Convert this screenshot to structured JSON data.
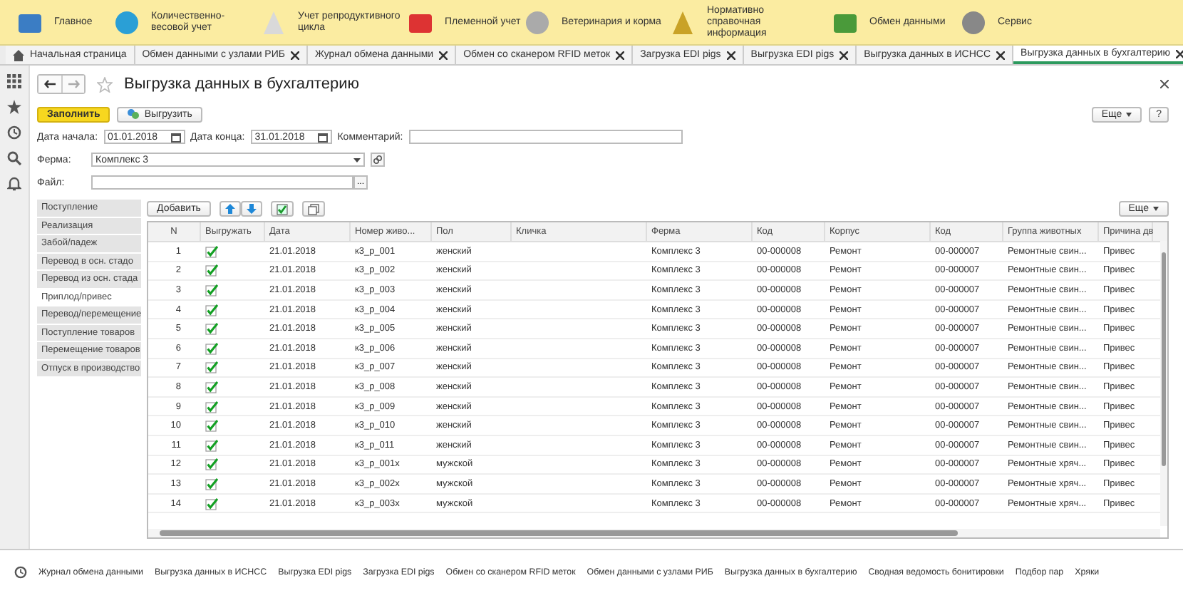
{
  "sections": [
    {
      "label": "Главное"
    },
    {
      "label": "Количественно-весовой учет"
    },
    {
      "label": "Учет репродуктивного цикла"
    },
    {
      "label": "Племенной учет"
    },
    {
      "label": "Ветеринария и корма"
    },
    {
      "label": "Нормативно справочная информация"
    },
    {
      "label": "Обмен данными"
    },
    {
      "label": "Сервис"
    }
  ],
  "tabs": [
    {
      "label": "Начальная страница",
      "selected": false,
      "closable": false
    },
    {
      "label": "Обмен данными с узлами РИБ",
      "selected": false,
      "closable": true
    },
    {
      "label": "Журнал обмена данными",
      "selected": false,
      "closable": true
    },
    {
      "label": "Обмен со сканером RFID меток",
      "selected": false,
      "closable": true
    },
    {
      "label": "Загрузка EDI pigs",
      "selected": false,
      "closable": true
    },
    {
      "label": "Выгрузка EDI pigs",
      "selected": false,
      "closable": true
    },
    {
      "label": "Выгрузка данных в ИСНСС",
      "selected": false,
      "closable": true
    },
    {
      "label": "Выгрузка данных в бухгалтерию",
      "selected": true,
      "closable": true
    }
  ],
  "form": {
    "title": "Выгрузка данных в бухгалтерию",
    "fill_button": "Заполнить",
    "export_button": "Выгрузить",
    "more_button": "Еще",
    "help_button": "?",
    "start_label": "Дата начала:",
    "start_value": "01.01.2018",
    "end_label": "Дата конца:",
    "end_value": "31.01.2018",
    "comment_label": "Комментарий:",
    "farm_label": "Ферма:",
    "farm_value": "Комплекс 3",
    "file_label": "Файл:",
    "file_button": "..."
  },
  "doc_types": [
    {
      "label": "Поступление",
      "selected": false
    },
    {
      "label": "Реализация",
      "selected": false
    },
    {
      "label": "Забой/падеж",
      "selected": false
    },
    {
      "label": "Перевод в осн. стадо",
      "selected": false
    },
    {
      "label": "Перевод из осн. стада",
      "selected": false
    },
    {
      "label": "Приплод/привес",
      "selected": true
    },
    {
      "label": "Перевод/перемещение",
      "selected": false
    },
    {
      "label": "Поступление товаров",
      "selected": false
    },
    {
      "label": "Перемещение товаров",
      "selected": false
    },
    {
      "label": "Отпуск в производство",
      "selected": false
    }
  ],
  "table": {
    "add_button": "Добавить",
    "more_button": "Еще",
    "columns": [
      "N",
      "Выгружать",
      "Дата",
      "Номер живо...",
      "Пол",
      "Кличка",
      "Ферма",
      "Код",
      "Корпус",
      "Код",
      "Группа животных",
      "Причина дв"
    ],
    "rows": [
      {
        "n": "1",
        "export": true,
        "date": "21.01.2018",
        "number": "к3_р_001",
        "sex": "женский",
        "farm": "Комплекс 3",
        "code": "00-000008",
        "building": "Ремонт",
        "code_2": "00-000007",
        "group": "Ремонтные свин...",
        "reason": "Привес"
      },
      {
        "n": "2",
        "export": true,
        "date": "21.01.2018",
        "number": "к3_р_002",
        "sex": "женский",
        "farm": "Комплекс 3",
        "code": "00-000008",
        "building": "Ремонт",
        "code_2": "00-000007",
        "group": "Ремонтные свин...",
        "reason": "Привес"
      },
      {
        "n": "3",
        "export": true,
        "date": "21.01.2018",
        "number": "к3_р_003",
        "sex": "женский",
        "farm": "Комплекс 3",
        "code": "00-000008",
        "building": "Ремонт",
        "code_2": "00-000007",
        "group": "Ремонтные свин...",
        "reason": "Привес"
      },
      {
        "n": "4",
        "export": true,
        "date": "21.01.2018",
        "number": "к3_р_004",
        "sex": "женский",
        "farm": "Комплекс 3",
        "code": "00-000008",
        "building": "Ремонт",
        "code_2": "00-000007",
        "group": "Ремонтные свин...",
        "reason": "Привес"
      },
      {
        "n": "5",
        "export": true,
        "date": "21.01.2018",
        "number": "к3_р_005",
        "sex": "женский",
        "farm": "Комплекс 3",
        "code": "00-000008",
        "building": "Ремонт",
        "code_2": "00-000007",
        "group": "Ремонтные свин...",
        "reason": "Привес"
      },
      {
        "n": "6",
        "export": true,
        "date": "21.01.2018",
        "number": "к3_р_006",
        "sex": "женский",
        "farm": "Комплекс 3",
        "code": "00-000008",
        "building": "Ремонт",
        "code_2": "00-000007",
        "group": "Ремонтные свин...",
        "reason": "Привес"
      },
      {
        "n": "7",
        "export": true,
        "date": "21.01.2018",
        "number": "к3_р_007",
        "sex": "женский",
        "farm": "Комплекс 3",
        "code": "00-000008",
        "building": "Ремонт",
        "code_2": "00-000007",
        "group": "Ремонтные свин...",
        "reason": "Привес"
      },
      {
        "n": "8",
        "export": true,
        "date": "21.01.2018",
        "number": "к3_р_008",
        "sex": "женский",
        "farm": "Комплекс 3",
        "code": "00-000008",
        "building": "Ремонт",
        "code_2": "00-000007",
        "group": "Ремонтные свин...",
        "reason": "Привес"
      },
      {
        "n": "9",
        "export": true,
        "date": "21.01.2018",
        "number": "к3_р_009",
        "sex": "женский",
        "farm": "Комплекс 3",
        "code": "00-000008",
        "building": "Ремонт",
        "code_2": "00-000007",
        "group": "Ремонтные свин...",
        "reason": "Привес"
      },
      {
        "n": "10",
        "export": true,
        "date": "21.01.2018",
        "number": "к3_р_010",
        "sex": "женский",
        "farm": "Комплекс 3",
        "code": "00-000008",
        "building": "Ремонт",
        "code_2": "00-000007",
        "group": "Ремонтные свин...",
        "reason": "Привес"
      },
      {
        "n": "11",
        "export": true,
        "date": "21.01.2018",
        "number": "к3_р_011",
        "sex": "женский",
        "farm": "Комплекс 3",
        "code": "00-000008",
        "building": "Ремонт",
        "code_2": "00-000007",
        "group": "Ремонтные свин...",
        "reason": "Привес"
      },
      {
        "n": "12",
        "export": true,
        "date": "21.01.2018",
        "number": "к3_р_001х",
        "sex": "мужской",
        "farm": "Комплекс 3",
        "code": "00-000008",
        "building": "Ремонт",
        "code_2": "00-000007",
        "group": "Ремонтные хряч...",
        "reason": "Привес"
      },
      {
        "n": "13",
        "export": true,
        "date": "21.01.2018",
        "number": "к3_р_002х",
        "sex": "мужской",
        "farm": "Комплекс 3",
        "code": "00-000008",
        "building": "Ремонт",
        "code_2": "00-000007",
        "group": "Ремонтные хряч...",
        "reason": "Привес"
      },
      {
        "n": "14",
        "export": true,
        "date": "21.01.2018",
        "number": "к3_р_003х",
        "sex": "мужской",
        "farm": "Комплекс 3",
        "code": "00-000008",
        "building": "Ремонт",
        "code_2": "00-000007",
        "group": "Ремонтные хряч...",
        "reason": "Привес"
      }
    ]
  },
  "history": [
    "Журнал обмена данными",
    "Выгрузка данных в ИСНСС",
    "Выгрузка EDI pigs",
    "Загрузка EDI pigs",
    "Обмен со сканером RFID меток",
    "Обмен данными с узлами РИБ",
    "Выгрузка данных в бухгалтерию",
    "Сводная ведомость бонитировки",
    "Подбор пар",
    "Хряки"
  ]
}
